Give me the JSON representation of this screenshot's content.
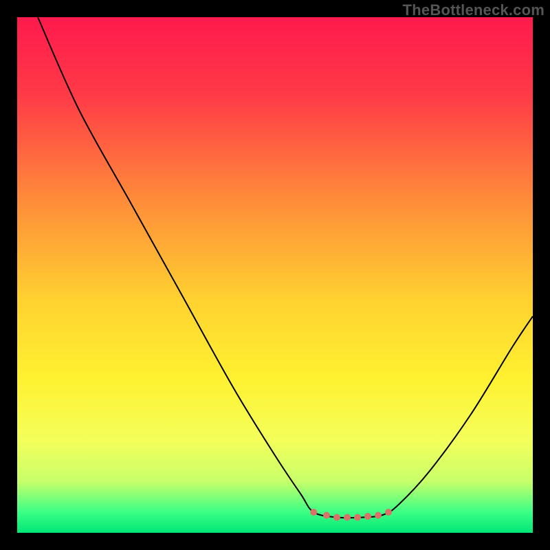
{
  "watermark": "TheBottleneck.com",
  "chart_data": {
    "type": "line",
    "title": "",
    "xlabel": "",
    "ylabel": "",
    "xlim": [
      0,
      100
    ],
    "ylim": [
      0,
      100
    ],
    "background_gradient": {
      "stops": [
        {
          "pos": 0.0,
          "color": "#ff1a4d"
        },
        {
          "pos": 0.15,
          "color": "#ff3a47"
        },
        {
          "pos": 0.35,
          "color": "#ff8a3a"
        },
        {
          "pos": 0.55,
          "color": "#ffd230"
        },
        {
          "pos": 0.7,
          "color": "#fff130"
        },
        {
          "pos": 0.82,
          "color": "#f4ff5a"
        },
        {
          "pos": 0.9,
          "color": "#c8ff6a"
        },
        {
          "pos": 0.96,
          "color": "#3bff85"
        },
        {
          "pos": 1.0,
          "color": "#00e676"
        }
      ]
    },
    "series": [
      {
        "name": "bottleneck-curve",
        "color": "#000000",
        "width": 2,
        "points": [
          {
            "x": 4.0,
            "y": 100.0
          },
          {
            "x": 12.0,
            "y": 82.0
          },
          {
            "x": 22.0,
            "y": 64.0
          },
          {
            "x": 32.0,
            "y": 46.0
          },
          {
            "x": 42.0,
            "y": 28.0
          },
          {
            "x": 50.0,
            "y": 15.0
          },
          {
            "x": 55.0,
            "y": 7.5
          },
          {
            "x": 57.5,
            "y": 4.0
          },
          {
            "x": 62.0,
            "y": 3.0
          },
          {
            "x": 67.0,
            "y": 3.0
          },
          {
            "x": 71.0,
            "y": 3.5
          },
          {
            "x": 74.0,
            "y": 5.5
          },
          {
            "x": 80.0,
            "y": 12.0
          },
          {
            "x": 88.0,
            "y": 23.0
          },
          {
            "x": 96.0,
            "y": 36.0
          },
          {
            "x": 100.0,
            "y": 42.0
          }
        ]
      }
    ],
    "markers": {
      "name": "highlight-band",
      "color": "#d9736a",
      "radius": 5,
      "points": [
        {
          "x": 57.5,
          "y": 4.0
        },
        {
          "x": 60.0,
          "y": 3.4
        },
        {
          "x": 62.0,
          "y": 3.0
        },
        {
          "x": 64.0,
          "y": 3.0
        },
        {
          "x": 66.0,
          "y": 3.0
        },
        {
          "x": 68.0,
          "y": 3.2
        },
        {
          "x": 70.0,
          "y": 3.4
        },
        {
          "x": 72.0,
          "y": 4.0
        }
      ]
    }
  }
}
